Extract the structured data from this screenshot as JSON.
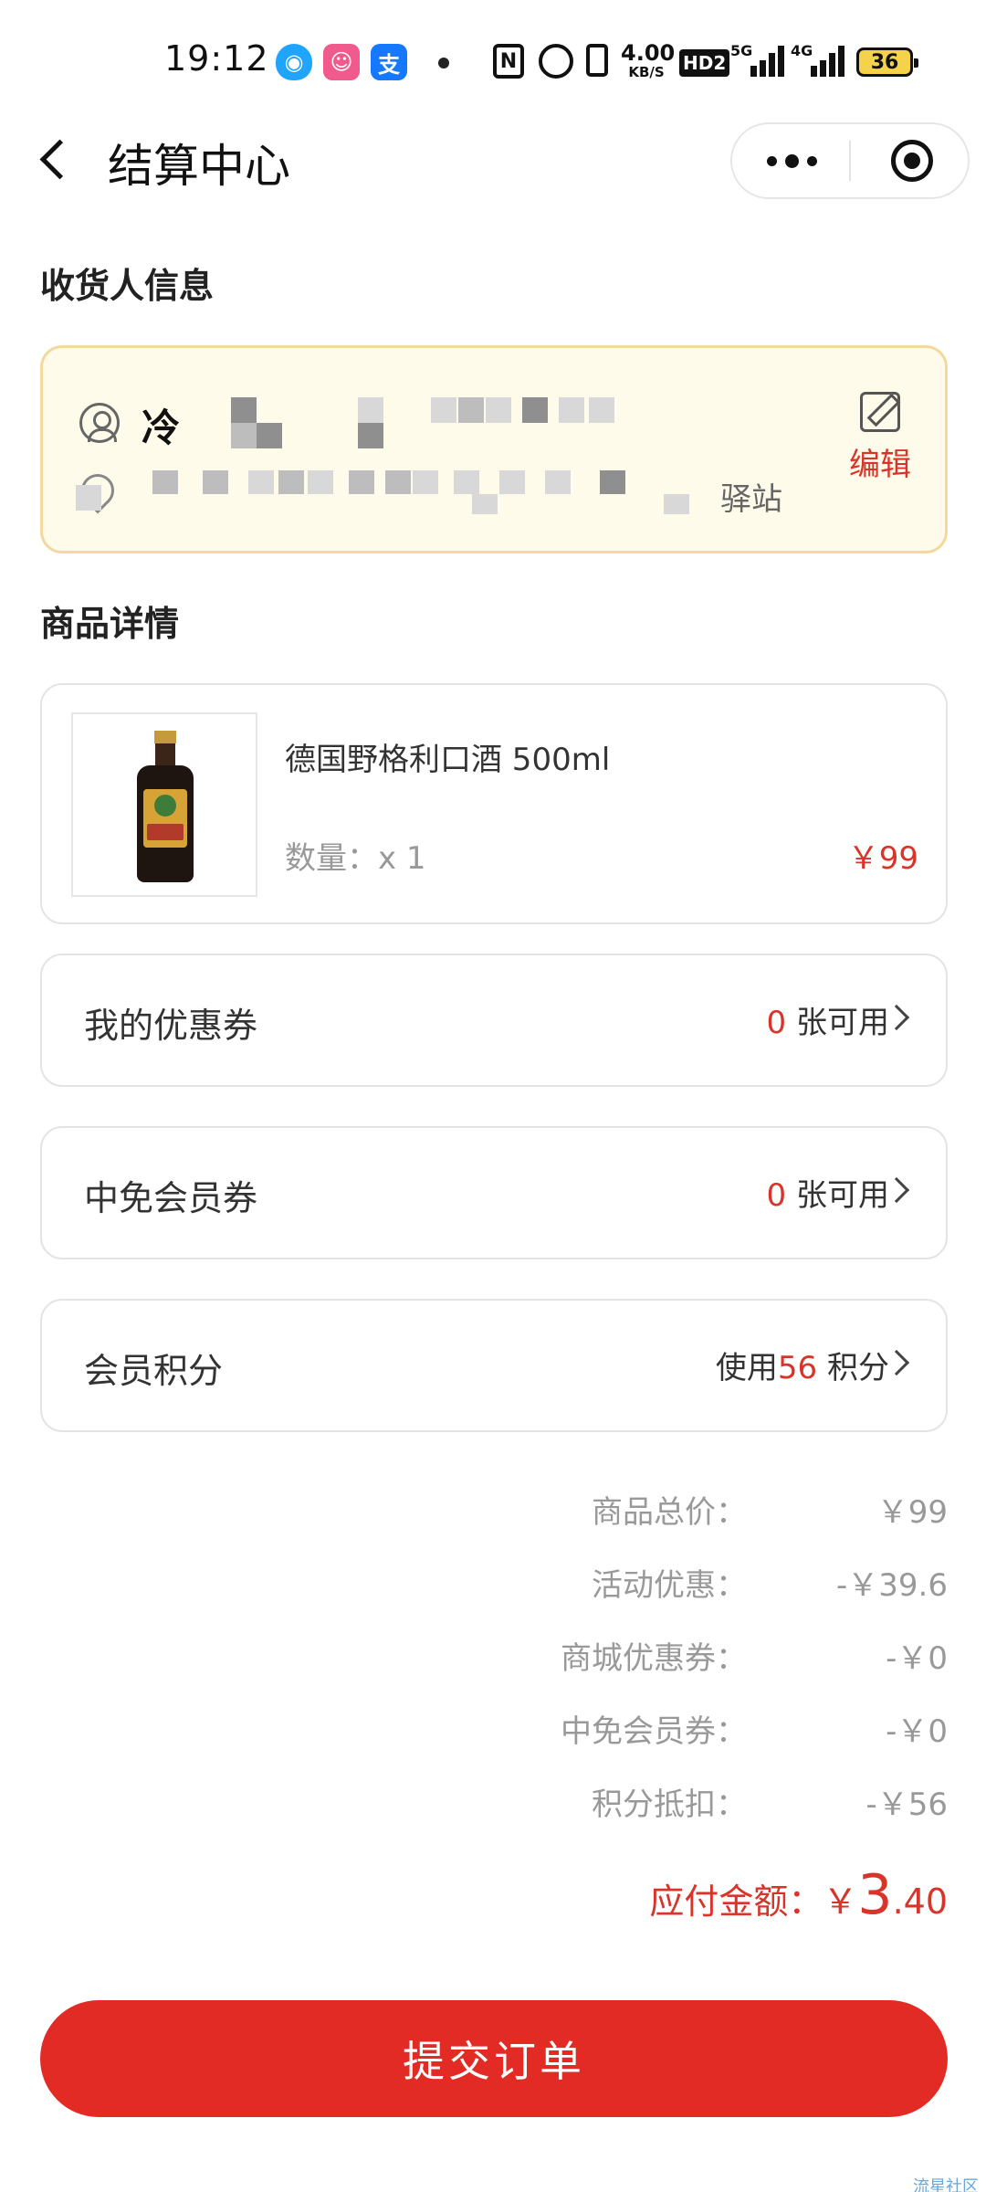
{
  "status_bar": {
    "time": "19:12",
    "app_icons": [
      {
        "name": "qq-icon",
        "glyph": "◉",
        "color": "#1fa5ff"
      },
      {
        "name": "picture-app-icon",
        "glyph": "☺",
        "color": "#f05a8c"
      },
      {
        "name": "alipay-icon",
        "glyph": "支",
        "color": "#1677ff"
      }
    ],
    "nfc_label": "N",
    "speed_value": "4.00",
    "speed_unit": "KB/S",
    "hd_label": "HD2",
    "signal_1": "5G",
    "signal_2": "4G",
    "battery": "36"
  },
  "nav": {
    "title": "结算中心"
  },
  "receiver": {
    "section_title": "收货人信息",
    "name": "冷",
    "address_suffix": "驿站",
    "edit_label": "编辑"
  },
  "goods": {
    "section_title": "商品详情",
    "name": "德国野格利口酒 500ml",
    "quantity": "数量：x 1",
    "price": "￥99"
  },
  "options": [
    {
      "label": "我的优惠券",
      "prefix": "",
      "count": "0",
      "suffix": " 张可用"
    },
    {
      "label": "中免会员券",
      "prefix": "",
      "count": "0",
      "suffix": " 张可用"
    },
    {
      "label": "会员积分",
      "prefix": "使用",
      "count": "56",
      "suffix": " 积分"
    }
  ],
  "summary": [
    {
      "label": "商品总价：",
      "value": "￥99"
    },
    {
      "label": "活动优惠：",
      "value": "-￥39.6"
    },
    {
      "label": "商城优惠券：",
      "value": "-￥0"
    },
    {
      "label": "中免会员券：",
      "value": "-￥0"
    },
    {
      "label": "积分抵扣：",
      "value": "-￥56"
    }
  ],
  "payable": {
    "label": "应付金额：",
    "currency": "￥",
    "integer": "3",
    "decimal": ".40"
  },
  "submit_label": "提交订单",
  "watermark": "流星社区",
  "colors": {
    "accent": "#e32b25",
    "price_red": "#d8342a",
    "address_card_bg": "#fffbea",
    "address_card_border": "#f3d9a0"
  }
}
